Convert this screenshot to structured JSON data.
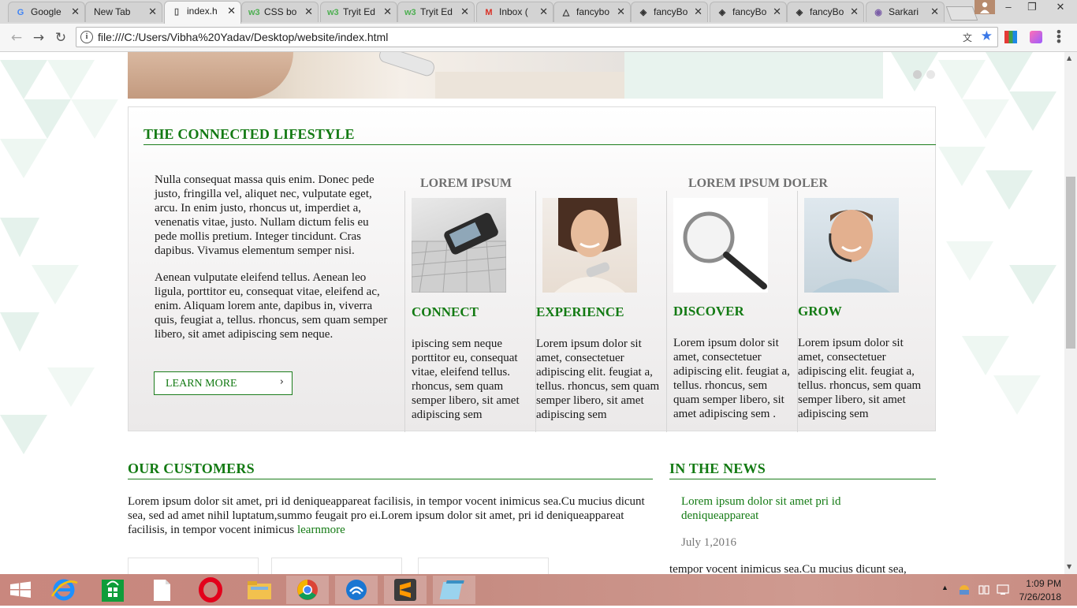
{
  "browser": {
    "tabs": [
      {
        "label": "Google",
        "icon": "google-icon",
        "glyph": "G",
        "color": "#4285f4"
      },
      {
        "label": "New Tab",
        "icon": "",
        "glyph": "",
        "color": "#333333"
      },
      {
        "label": "index.h",
        "icon": "page-icon",
        "glyph": "▯",
        "color": "#555555",
        "active": true
      },
      {
        "label": "CSS bo",
        "icon": "w3schools-icon",
        "glyph": "w3",
        "color": "#4caf50"
      },
      {
        "label": "Tryit Ed",
        "icon": "w3schools-icon",
        "glyph": "w3",
        "color": "#4caf50"
      },
      {
        "label": "Tryit Ed",
        "icon": "w3schools-icon",
        "glyph": "w3",
        "color": "#4caf50"
      },
      {
        "label": "Inbox (",
        "icon": "gmail-icon",
        "glyph": "M",
        "color": "#d93025"
      },
      {
        "label": "fancybo",
        "icon": "drive-icon",
        "glyph": "△",
        "color": "#333333"
      },
      {
        "label": "fancyBo",
        "icon": "codepen-icon",
        "glyph": "◈",
        "color": "#333333"
      },
      {
        "label": "fancyBo",
        "icon": "codepen-icon",
        "glyph": "◈",
        "color": "#333333"
      },
      {
        "label": "fancyBo",
        "icon": "codepen-icon",
        "glyph": "◈",
        "color": "#333333"
      },
      {
        "label": "Sarkari",
        "icon": "sarkari-icon",
        "glyph": "◉",
        "color": "#7b5ea7"
      }
    ],
    "url": "file:///C:/Users/Vibha%20Yadav/Desktop/website/index.html"
  },
  "page": {
    "lifestyle": {
      "title": "THE CONNECTED LIFESTYLE",
      "paragraph1": "Nulla consequat massa quis enim. Donec pede justo, fringilla vel, aliquet nec, vulputate eget, arcu. In enim justo, rhoncus ut, imperdiet a, venenatis vitae, justo. Nullam dictum felis eu pede mollis pretium. Integer tincidunt. Cras dapibus. Vivamus elementum semper nisi.",
      "paragraph2": "Aenean vulputate eleifend tellus. Aenean leo ligula, porttitor eu, consequat vitae, eleifend ac, enim. Aliquam lorem ante, dapibus in, viverra quis, feugiat a, tellus. rhoncus, sem quam semper libero, sit amet adipiscing sem neque.",
      "button_label": "LEARN MORE",
      "group1_title": "LOREM IPSUM",
      "group2_title": "LOREM IPSUM DOLER",
      "cards": [
        {
          "title": "CONNECT",
          "text": "ipiscing sem neque porttitor eu, consequat vitae, eleifend tellus. rhoncus, sem quam semper libero, sit amet adipiscing sem"
        },
        {
          "title": "EXPERIENCE",
          "text": "Lorem ipsum dolor sit amet, consectetuer adipiscing elit. feugiat a, tellus. rhoncus, sem quam semper libero, sit amet adipiscing sem"
        },
        {
          "title": "DISCOVER",
          "text": "Lorem ipsum dolor sit amet, consectetuer adipiscing elit. feugiat a, tellus. rhoncus, sem quam semper libero, sit amet adipiscing sem ."
        },
        {
          "title": "GROW",
          "text": "Lorem ipsum dolor sit amet, consectetuer adipiscing elit. feugiat a, tellus. rhoncus, sem quam semper libero, sit amet adipiscing sem"
        }
      ]
    },
    "customers": {
      "title": "OUR CUSTOMERS",
      "text": "Lorem ipsum dolor sit amet, pri id deniqueappareat facilisis, in tempor vocent inimicus sea.Cu mucius dicunt sea, sed ad amet nihil luptatum,summo feugait pro ei.Lorem ipsum dolor sit amet, pri id deniqueappareat facilisis, in tempor vocent inimicus",
      "link": "learnmore"
    },
    "news": {
      "title": "IN THE NEWS",
      "headline": "Lorem ipsum dolor sit amet pri id deniqueappareat",
      "date": "July 1,2016",
      "snippet": "tempor vocent inimicus sea.Cu mucius dicunt sea,"
    }
  },
  "taskbar": {
    "apps": [
      "windows-start-icon",
      "internet-explorer-icon",
      "windows-store-icon",
      "file-icon",
      "opera-icon",
      "file-explorer-icon",
      "chrome-icon",
      "network-app-icon",
      "sublime-text-icon",
      "notepad-icon"
    ],
    "time": "1:09 PM",
    "date": "7/26/2018"
  },
  "colors": {
    "accent_green": "#137a13",
    "heading_gray": "#6f6f6f",
    "taskbar": "#c9877e"
  }
}
